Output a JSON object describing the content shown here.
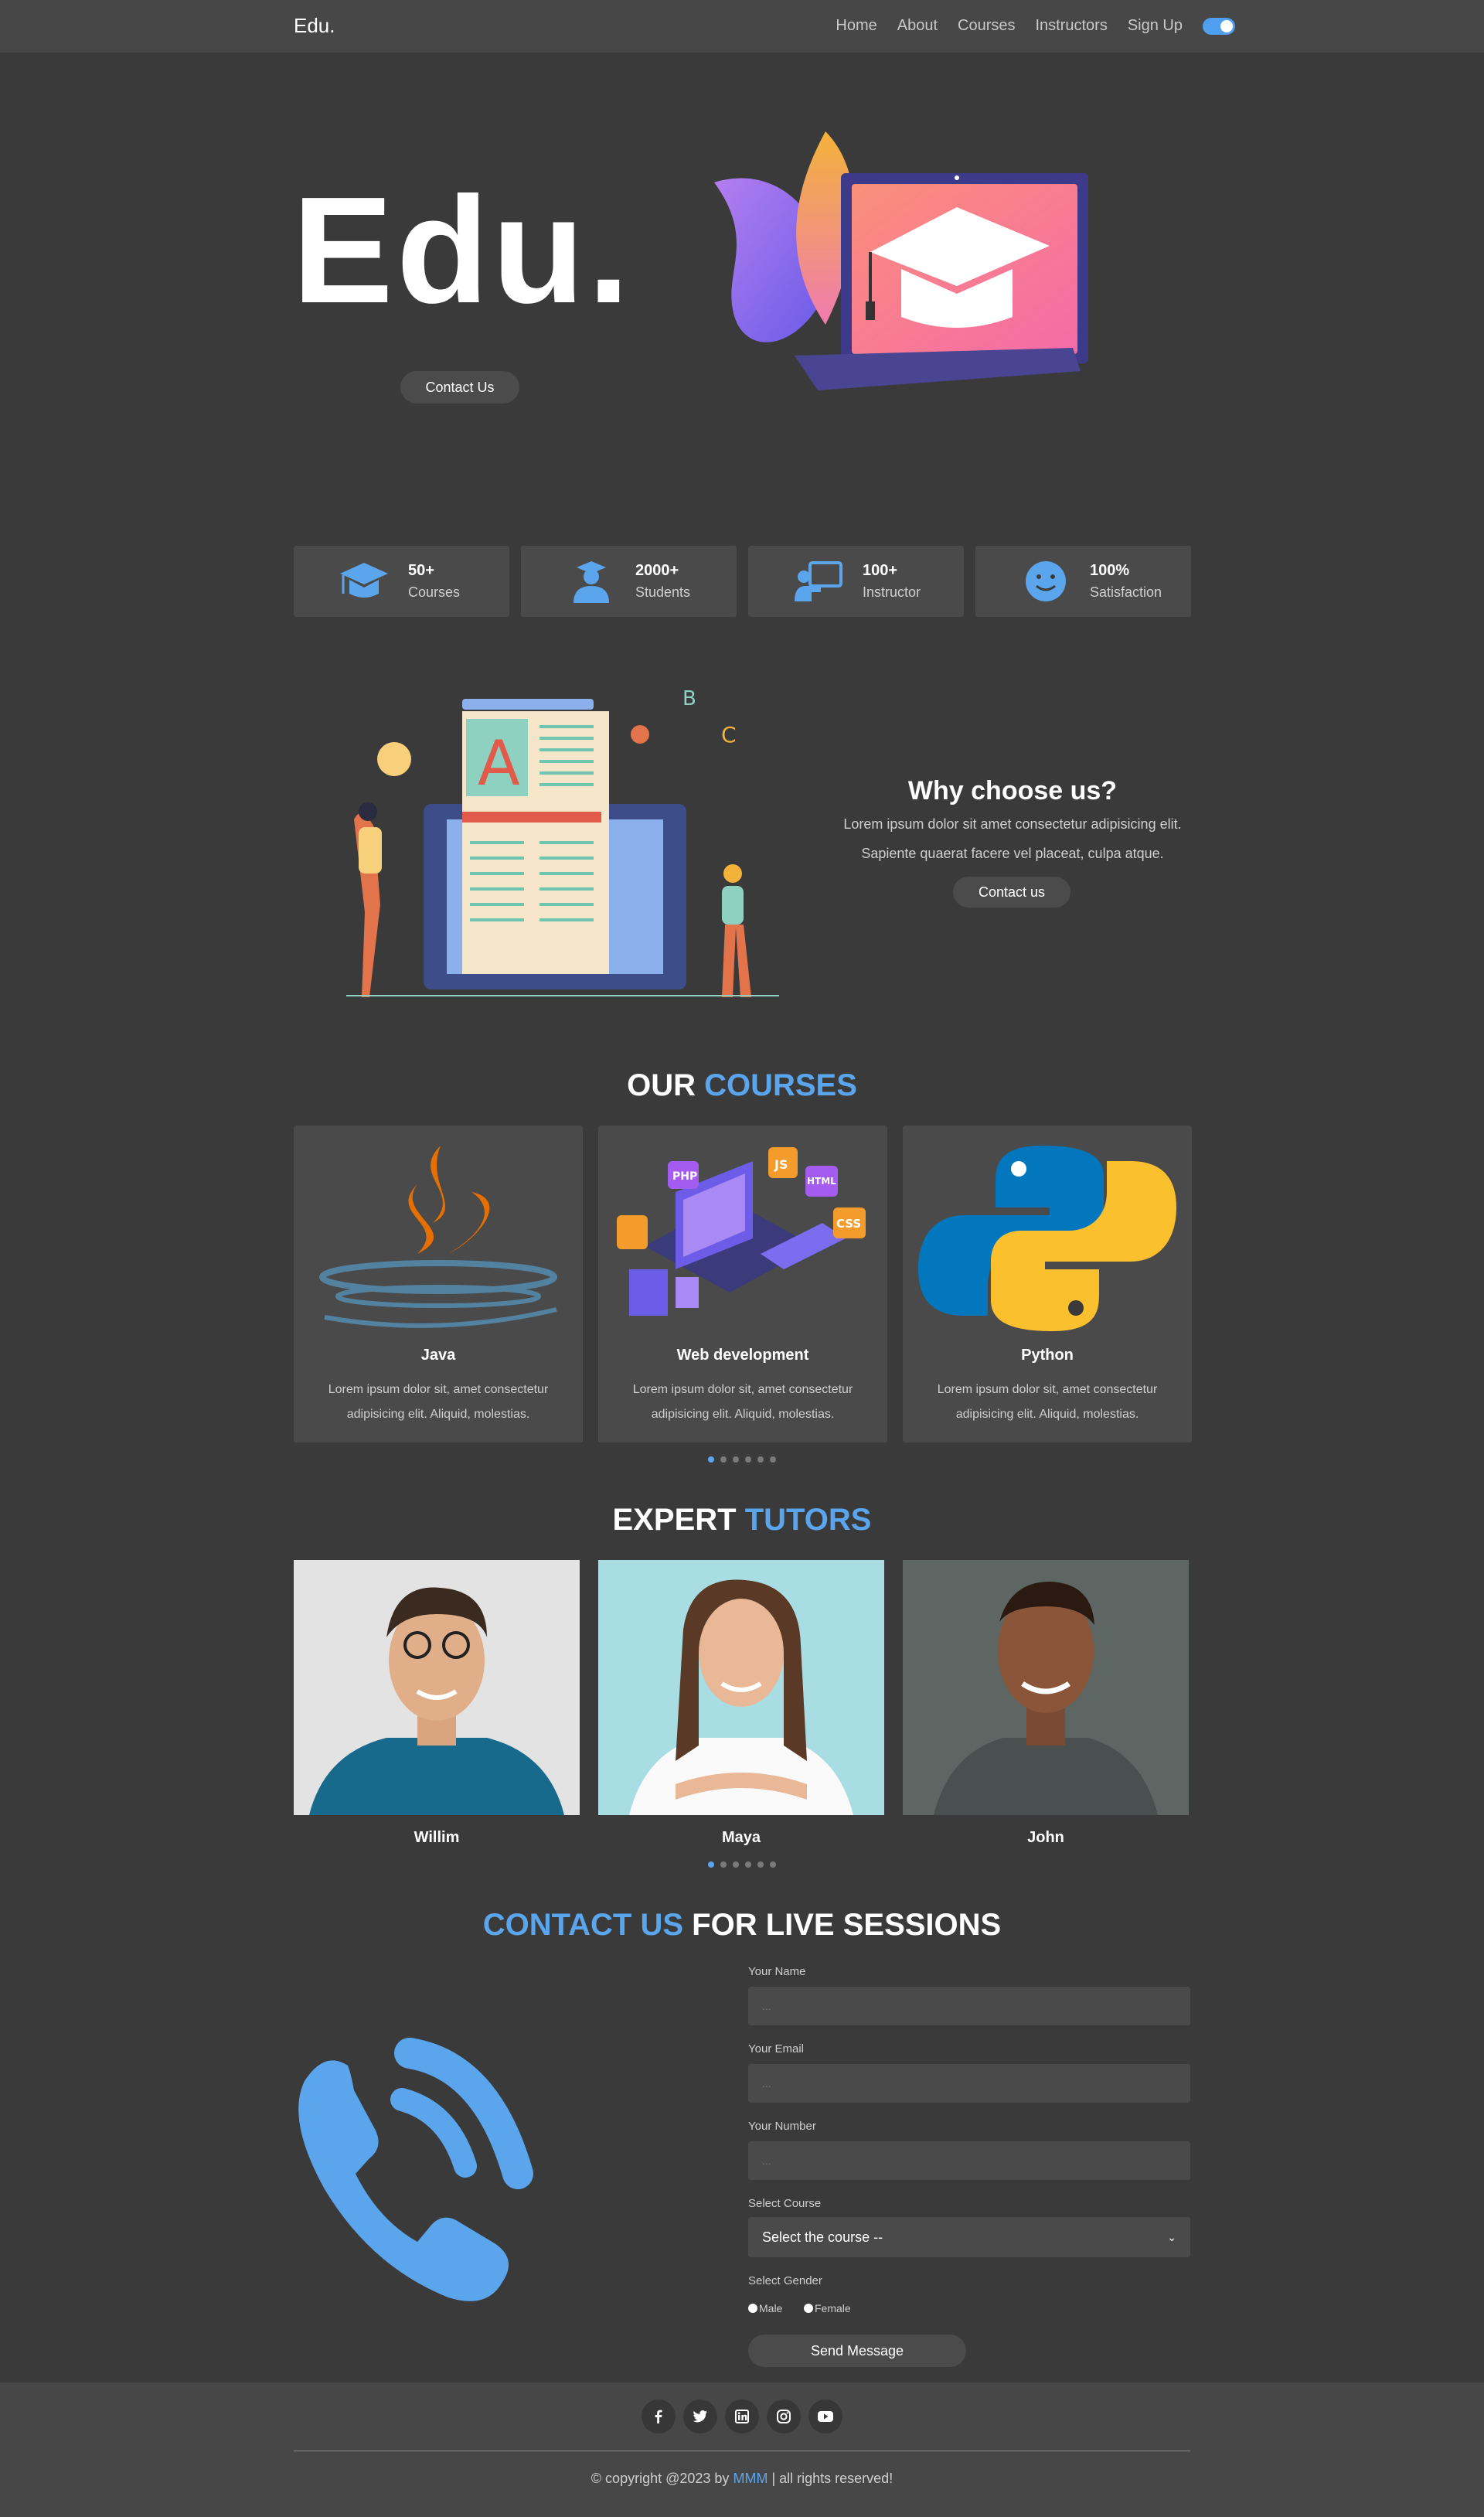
{
  "nav": {
    "brand": "Edu.",
    "links": [
      "Home",
      "About",
      "Courses",
      "Instructors",
      "Sign Up"
    ],
    "theme_toggle_on": true
  },
  "hero": {
    "title": "Edu.",
    "button": "Contact Us"
  },
  "stats": [
    {
      "value": "50+",
      "label": "Courses",
      "icon": "graduation-cap-icon"
    },
    {
      "value": "2000+",
      "label": "Students",
      "icon": "student-icon"
    },
    {
      "value": "100+",
      "label": "Instructor",
      "icon": "teacher-board-icon"
    },
    {
      "value": "100%",
      "label": "Satisfaction",
      "icon": "smile-icon"
    }
  ],
  "why": {
    "title": "Why choose us?",
    "line1": "Lorem ipsum dolor sit amet consectetur adipisicing elit.",
    "line2": "Sapiente quaerat facere vel placeat, culpa atque.",
    "button": "Contact us"
  },
  "courses": {
    "title_white": "OUR",
    "title_blue": "COURSES",
    "items": [
      {
        "name": "Java",
        "desc": "Lorem ipsum dolor sit, amet consectetur adipisicing elit. Aliquid, molestias."
      },
      {
        "name": "Web development",
        "desc": "Lorem ipsum dolor sit, amet consectetur adipisicing elit. Aliquid, molestias."
      },
      {
        "name": "Python",
        "desc": "Lorem ipsum dolor sit, amet consectetur adipisicing elit. Aliquid, molestias."
      }
    ],
    "web_badges": [
      "PHP",
      "JS",
      "HTML",
      "CSS"
    ],
    "dots": 6,
    "active_dot": 0
  },
  "tutors": {
    "title_white": "EXPERT",
    "title_blue": "TUTORS",
    "items": [
      {
        "name": "Willim"
      },
      {
        "name": "Maya"
      },
      {
        "name": "John"
      }
    ],
    "dots": 6,
    "active_dot": 0
  },
  "contact": {
    "title_blue": "CONTACT US",
    "title_white": "FOR LIVE SESSIONS",
    "name_label": "Your Name",
    "email_label": "Email",
    "email_label_full": "Your Email",
    "number_label": "Your Number",
    "placeholder": "...",
    "course_label": "Select Course",
    "course_value": "Select the course --",
    "gender_label": "Select Gender",
    "gender_male": "Male",
    "gender_female": "Female",
    "send_button": "Send Message"
  },
  "footer": {
    "socials": [
      "facebook-icon",
      "twitter-icon",
      "linkedin-icon",
      "instagram-icon",
      "youtube-icon"
    ],
    "copy_prefix": "© copyright @2023 by",
    "copy_name": "MMM",
    "copy_suffix": "| all rights reserved!"
  },
  "colors": {
    "background": "#3a3a3a",
    "panel": "#4a4a4a",
    "accent": "#5aa5ec"
  }
}
